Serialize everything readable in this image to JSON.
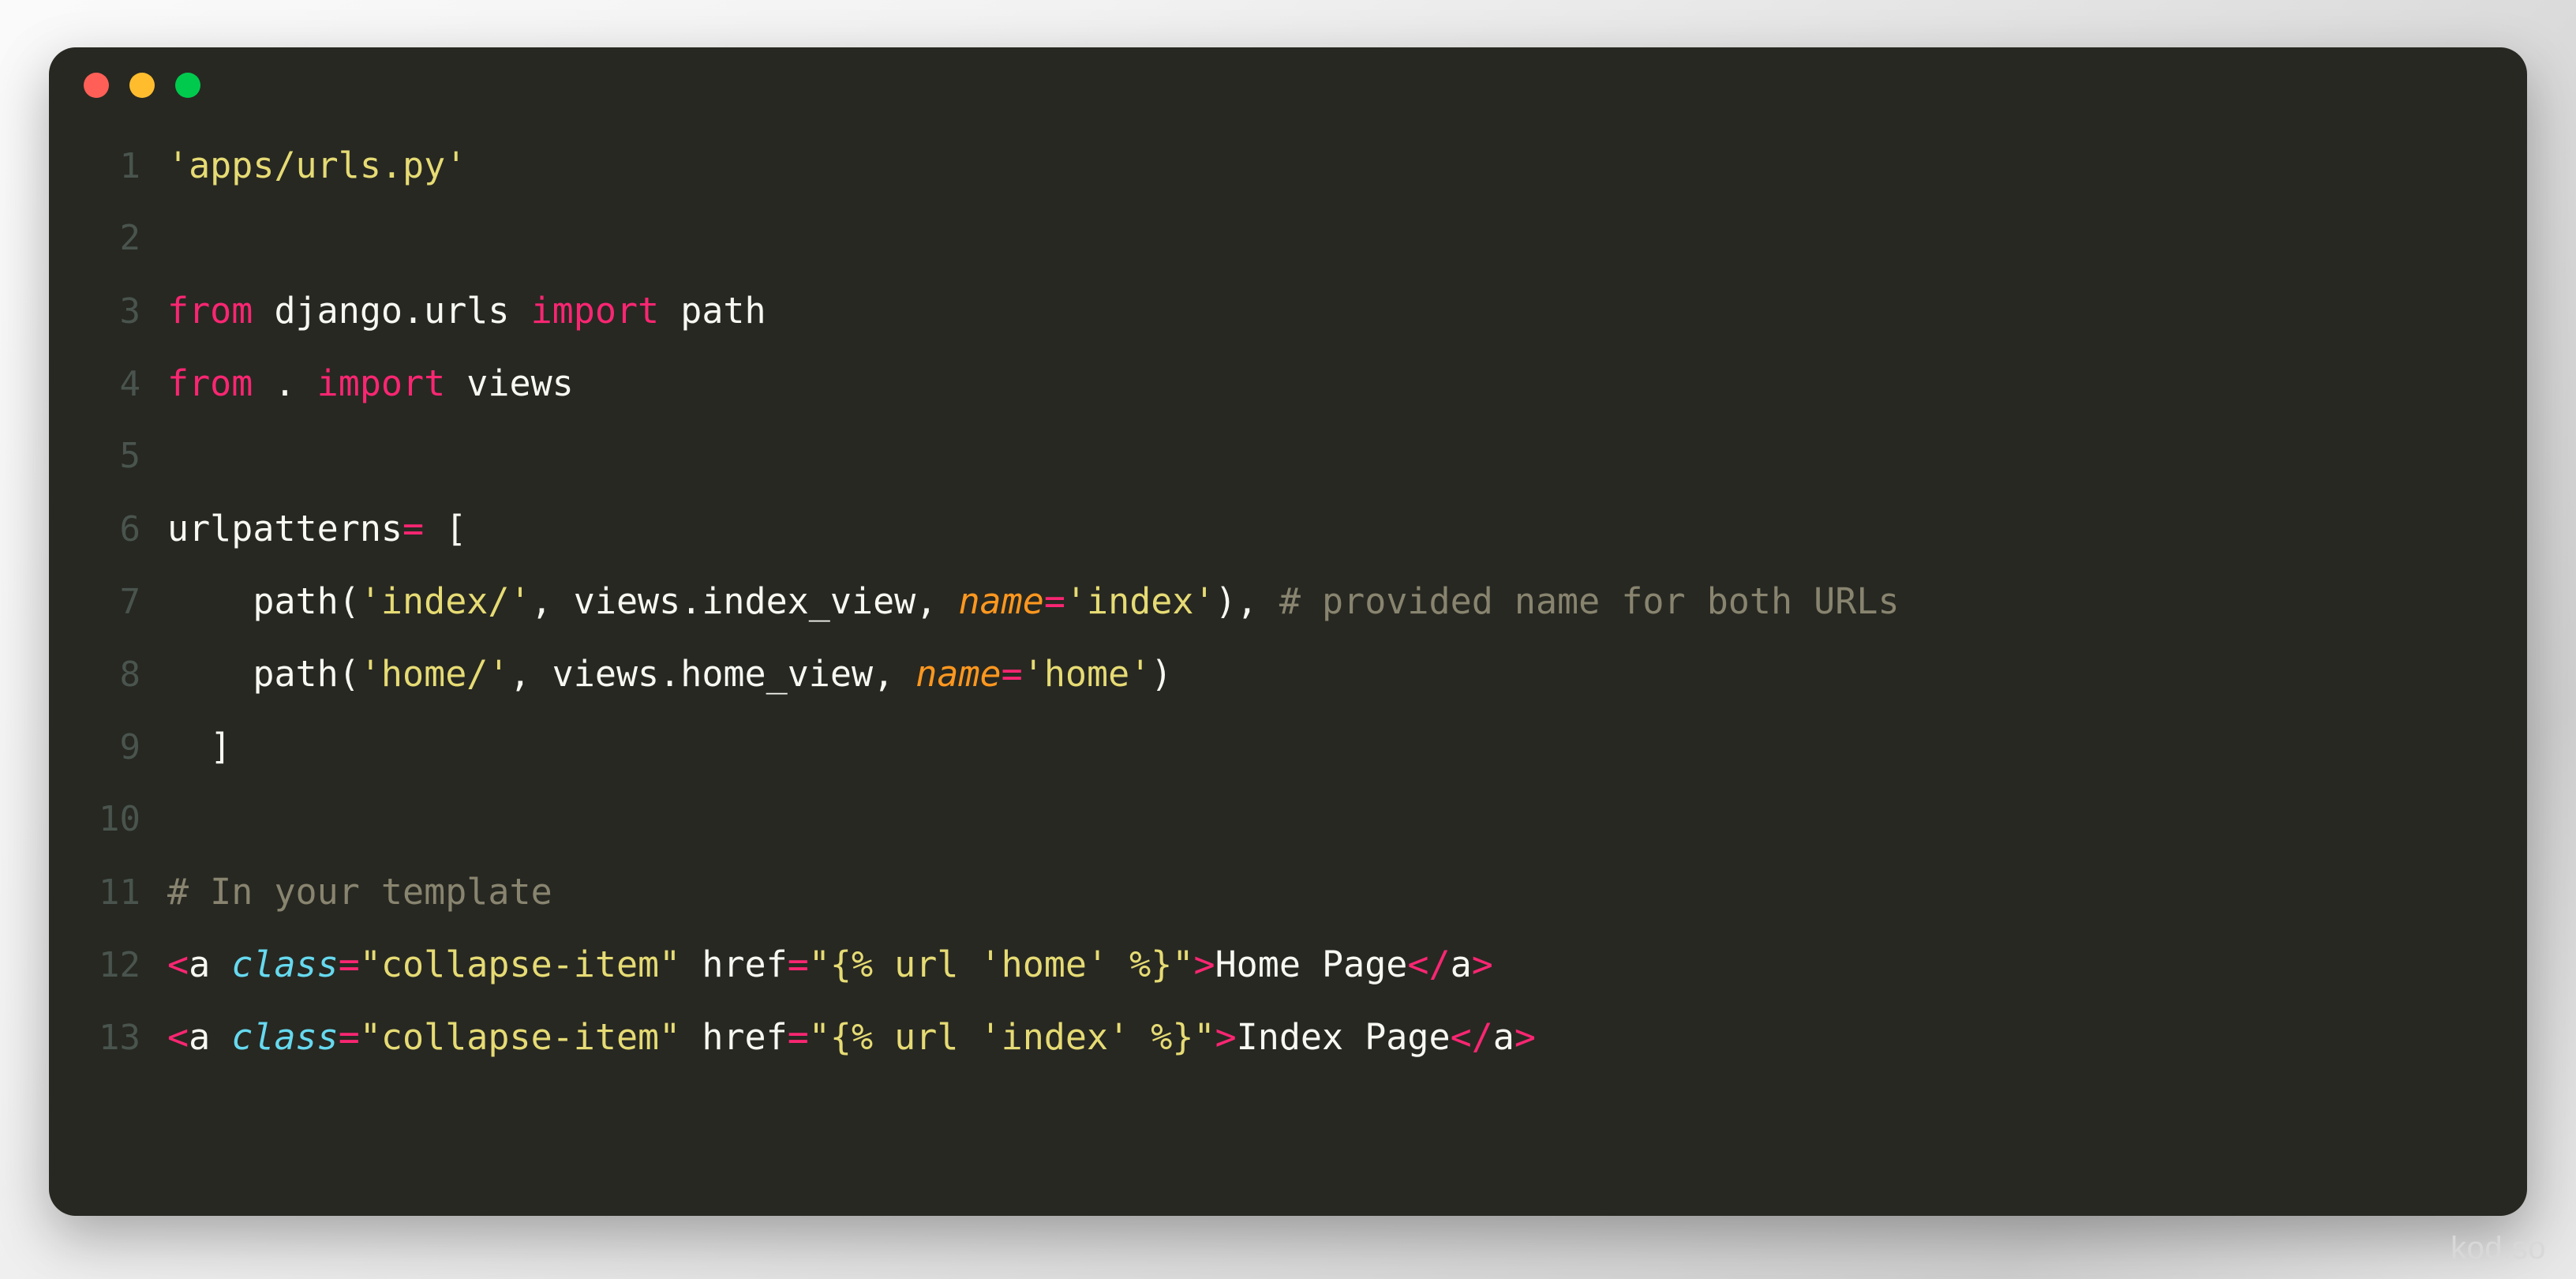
{
  "window": {
    "dots": [
      {
        "name": "close",
        "color": "#ff5f56"
      },
      {
        "name": "minimize",
        "color": "#ffbd2e"
      },
      {
        "name": "maximize",
        "color": "#00ca4e"
      }
    ],
    "background_color": "#272822"
  },
  "watermark": {
    "text": "kod.so"
  },
  "editor": {
    "language": "python",
    "theme": "monokai",
    "line_numbers": [
      "1",
      "2",
      "3",
      "4",
      "5",
      "6",
      "7",
      "8",
      "9",
      "10",
      "11",
      "12",
      "13"
    ],
    "plain_text": [
      "'apps/urls.py'",
      "",
      "from django.urls import path",
      "from . import views",
      "",
      "urlpatterns= [",
      "    path('index/', views.index_view, name='index'), # provided name for both URLs",
      "    path('home/', views.home_view, name='home')",
      "  ]",
      "",
      "# In your template",
      "<a class=\"collapse-item\" href=\"{% url 'home' %}\">Home Page</a>",
      "<a class=\"collapse-item\" href=\"{% url 'index' %}\">Index Page</a>"
    ],
    "lines": [
      {
        "number": "1",
        "tokens": [
          {
            "t": "'apps/urls.py'",
            "c": "t-str"
          }
        ]
      },
      {
        "number": "2",
        "tokens": []
      },
      {
        "number": "3",
        "tokens": [
          {
            "t": "from",
            "c": "t-kw"
          },
          {
            "t": " django.urls ",
            "c": "t-plain"
          },
          {
            "t": "import",
            "c": "t-kw"
          },
          {
            "t": " path",
            "c": "t-plain"
          }
        ]
      },
      {
        "number": "4",
        "tokens": [
          {
            "t": "from",
            "c": "t-kw"
          },
          {
            "t": " . ",
            "c": "t-plain"
          },
          {
            "t": "import",
            "c": "t-kw"
          },
          {
            "t": " views",
            "c": "t-plain"
          }
        ]
      },
      {
        "number": "5",
        "tokens": []
      },
      {
        "number": "6",
        "tokens": [
          {
            "t": "urlpatterns",
            "c": "t-plain"
          },
          {
            "t": "=",
            "c": "t-kw"
          },
          {
            "t": " [",
            "c": "t-plain"
          }
        ]
      },
      {
        "number": "7",
        "tokens": [
          {
            "t": "    path(",
            "c": "t-plain"
          },
          {
            "t": "'index/'",
            "c": "t-str"
          },
          {
            "t": ", views.index_view, ",
            "c": "t-plain"
          },
          {
            "t": "name",
            "c": "t-param"
          },
          {
            "t": "=",
            "c": "t-kw"
          },
          {
            "t": "'index'",
            "c": "t-str"
          },
          {
            "t": "), ",
            "c": "t-plain"
          },
          {
            "t": "# provided name for both URLs",
            "c": "t-comment"
          }
        ]
      },
      {
        "number": "8",
        "tokens": [
          {
            "t": "    path(",
            "c": "t-plain"
          },
          {
            "t": "'home/'",
            "c": "t-str"
          },
          {
            "t": ", views.home_view, ",
            "c": "t-plain"
          },
          {
            "t": "name",
            "c": "t-param"
          },
          {
            "t": "=",
            "c": "t-kw"
          },
          {
            "t": "'home'",
            "c": "t-str"
          },
          {
            "t": ")",
            "c": "t-plain"
          }
        ]
      },
      {
        "number": "9",
        "tokens": [
          {
            "t": "  ]",
            "c": "t-plain"
          }
        ]
      },
      {
        "number": "10",
        "tokens": []
      },
      {
        "number": "11",
        "tokens": [
          {
            "t": "# In your template",
            "c": "t-comment"
          }
        ]
      },
      {
        "number": "12",
        "tokens": [
          {
            "t": "<",
            "c": "t-kw"
          },
          {
            "t": "a ",
            "c": "t-plain"
          },
          {
            "t": "class",
            "c": "t-attr"
          },
          {
            "t": "=",
            "c": "t-kw"
          },
          {
            "t": "\"collapse-item\"",
            "c": "t-str"
          },
          {
            "t": " href",
            "c": "t-plain"
          },
          {
            "t": "=",
            "c": "t-kw"
          },
          {
            "t": "\"{% url 'home' %}\"",
            "c": "t-str"
          },
          {
            "t": ">",
            "c": "t-kw"
          },
          {
            "t": "Home Page",
            "c": "t-plain"
          },
          {
            "t": "</",
            "c": "t-kw"
          },
          {
            "t": "a",
            "c": "t-plain"
          },
          {
            "t": ">",
            "c": "t-kw"
          }
        ]
      },
      {
        "number": "13",
        "tokens": [
          {
            "t": "<",
            "c": "t-kw"
          },
          {
            "t": "a ",
            "c": "t-plain"
          },
          {
            "t": "class",
            "c": "t-attr"
          },
          {
            "t": "=",
            "c": "t-kw"
          },
          {
            "t": "\"collapse-item\"",
            "c": "t-str"
          },
          {
            "t": " href",
            "c": "t-plain"
          },
          {
            "t": "=",
            "c": "t-kw"
          },
          {
            "t": "\"{% url 'index' %}\"",
            "c": "t-str"
          },
          {
            "t": ">",
            "c": "t-kw"
          },
          {
            "t": "Index Page",
            "c": "t-plain"
          },
          {
            "t": "</",
            "c": "t-kw"
          },
          {
            "t": "a",
            "c": "t-plain"
          },
          {
            "t": ">",
            "c": "t-kw"
          }
        ]
      }
    ]
  }
}
